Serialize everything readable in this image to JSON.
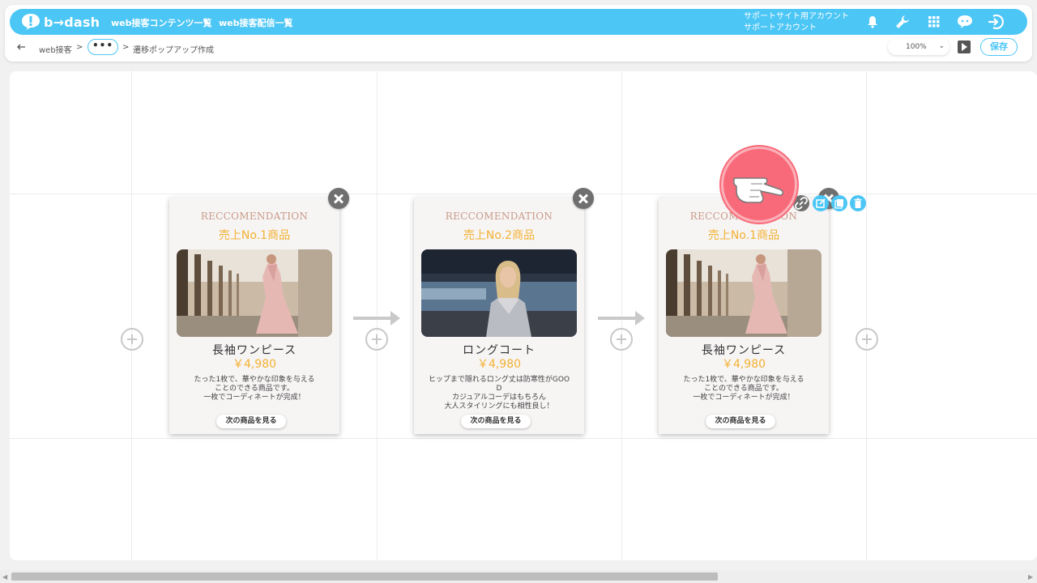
{
  "app": {
    "logo_text": "b→dash",
    "nav": [
      "web接客コンテンツ一覧",
      "web接客配信一覧"
    ],
    "account": [
      "サポートサイト用アカウント",
      "サポートアカウント"
    ]
  },
  "toolbar": {
    "crumb1": "web接客",
    "sep": ">",
    "dots": "•••",
    "sep2": ">",
    "crumb3": "遷移ポップアップ作成",
    "zoom": "100%",
    "save_label": "保存"
  },
  "cards": [
    {
      "reco": "RECCOMENDATION",
      "rank": "売上No.1商品",
      "name": "長袖ワンピース",
      "price": "￥4,980",
      "desc": "たった1枚で、華やかな印象を与える\nことのできる商品です。\n一枚でコーディネートが完成！",
      "next": "次の商品を見る"
    },
    {
      "reco": "RECCOMENDATION",
      "rank": "売上No.2商品",
      "name": "ロングコート",
      "price": "￥4,980",
      "desc": "ヒップまで隠れるロング丈は防寒性がGOO\nD\nカジュアルコーデはもちろん\n大人スタイリングにも相性良し！",
      "next": "次の商品を見る"
    },
    {
      "reco": "RECCOMENDATION",
      "rank": "売上No.1商品",
      "name": "長袖ワンピース",
      "price": "￥4,980",
      "desc": "たった1枚で、華やかな印象を与える\nことのできる商品です。\n一枚でコーディネートが完成！",
      "next": "次の商品を見る"
    }
  ],
  "colors": {
    "accent": "#4cc6f5",
    "price": "#f2b233",
    "cursor": "#f86a79"
  }
}
